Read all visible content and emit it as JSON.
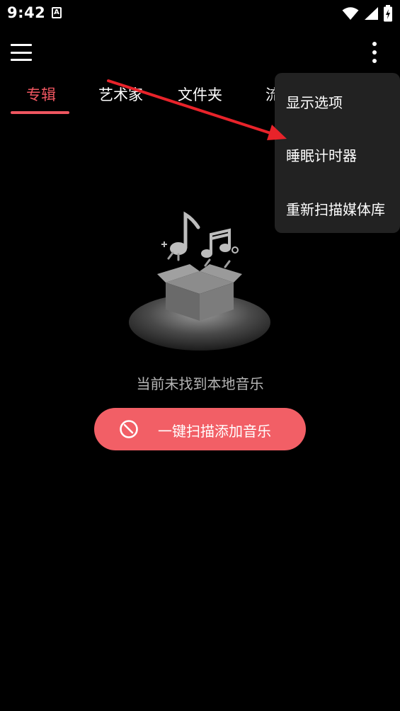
{
  "status_bar": {
    "time": "9:42",
    "notification_icon_letter": "A"
  },
  "app_bar": {
    "menu_icon": "hamburger-menu-icon",
    "more_icon": "more-vert-icon"
  },
  "tabs": [
    {
      "label": "专辑",
      "active": true
    },
    {
      "label": "艺术家",
      "active": false
    },
    {
      "label": "文件夹",
      "active": false
    },
    {
      "label": "流",
      "active": false
    }
  ],
  "overflow_menu": {
    "items": [
      {
        "label": "显示选项"
      },
      {
        "label": "睡眠计时器"
      },
      {
        "label": "重新扫描媒体库"
      }
    ]
  },
  "empty_state": {
    "message": "当前未找到本地音乐",
    "scan_button_label": "一键扫描添加音乐",
    "scan_icon": "refresh-circle-icon"
  },
  "colors": {
    "accent": "#ef5660",
    "button": "#f25f66",
    "menu_background": "#222222",
    "annotation": "#e8232a"
  }
}
